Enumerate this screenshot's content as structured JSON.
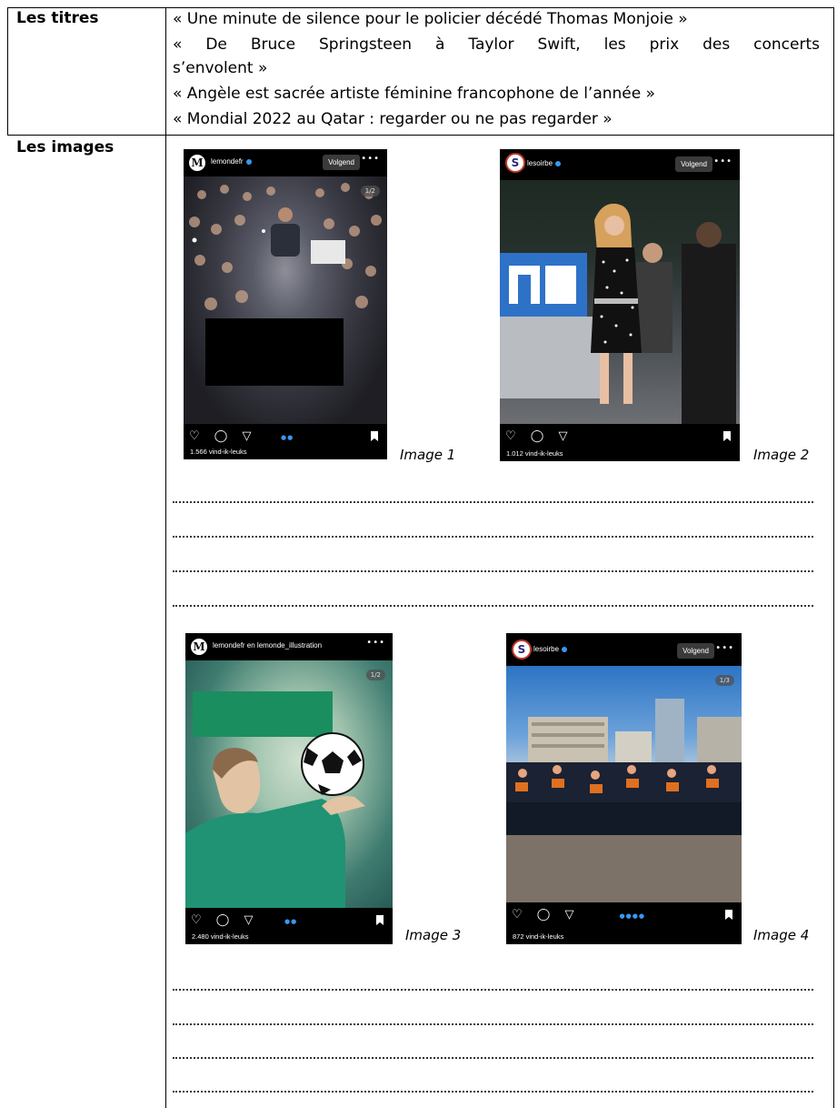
{
  "labels": {
    "titres": "Les titres",
    "images": "Les images"
  },
  "titles": [
    "« Une minute de silence pour le policier décédé Thomas Monjoie »",
    "« De Bruce Springsteen à Taylor Swift, les prix des concerts",
    "s’envolent »",
    "« Angèle est sacrée artiste féminine francophone de l’année »",
    "« Mondial 2022 au Qatar : regarder ou ne pas regarder »"
  ],
  "images": [
    {
      "account": "lemondefr",
      "follow": "Volgend",
      "likes": "1.566 vind-ik-leuks",
      "counter": "1/2",
      "caption": "Image 1"
    },
    {
      "account": "lesoirbe",
      "follow": "Volgend",
      "likes": "1.012 vind-ik-leuks",
      "caption": "Image 2"
    },
    {
      "account": "lemondefr en lemonde_illustration",
      "likes": "2.480 vind-ik-leuks",
      "counter": "1/2",
      "caption": "Image 3"
    },
    {
      "account": "lesoirbe",
      "follow": "Volgend",
      "likes": "872 vind-ik-leuks",
      "counter": "1/3",
      "caption": "Image 4"
    }
  ],
  "icons": {
    "actions": "♡ ◯ ▽",
    "more": "•••"
  }
}
